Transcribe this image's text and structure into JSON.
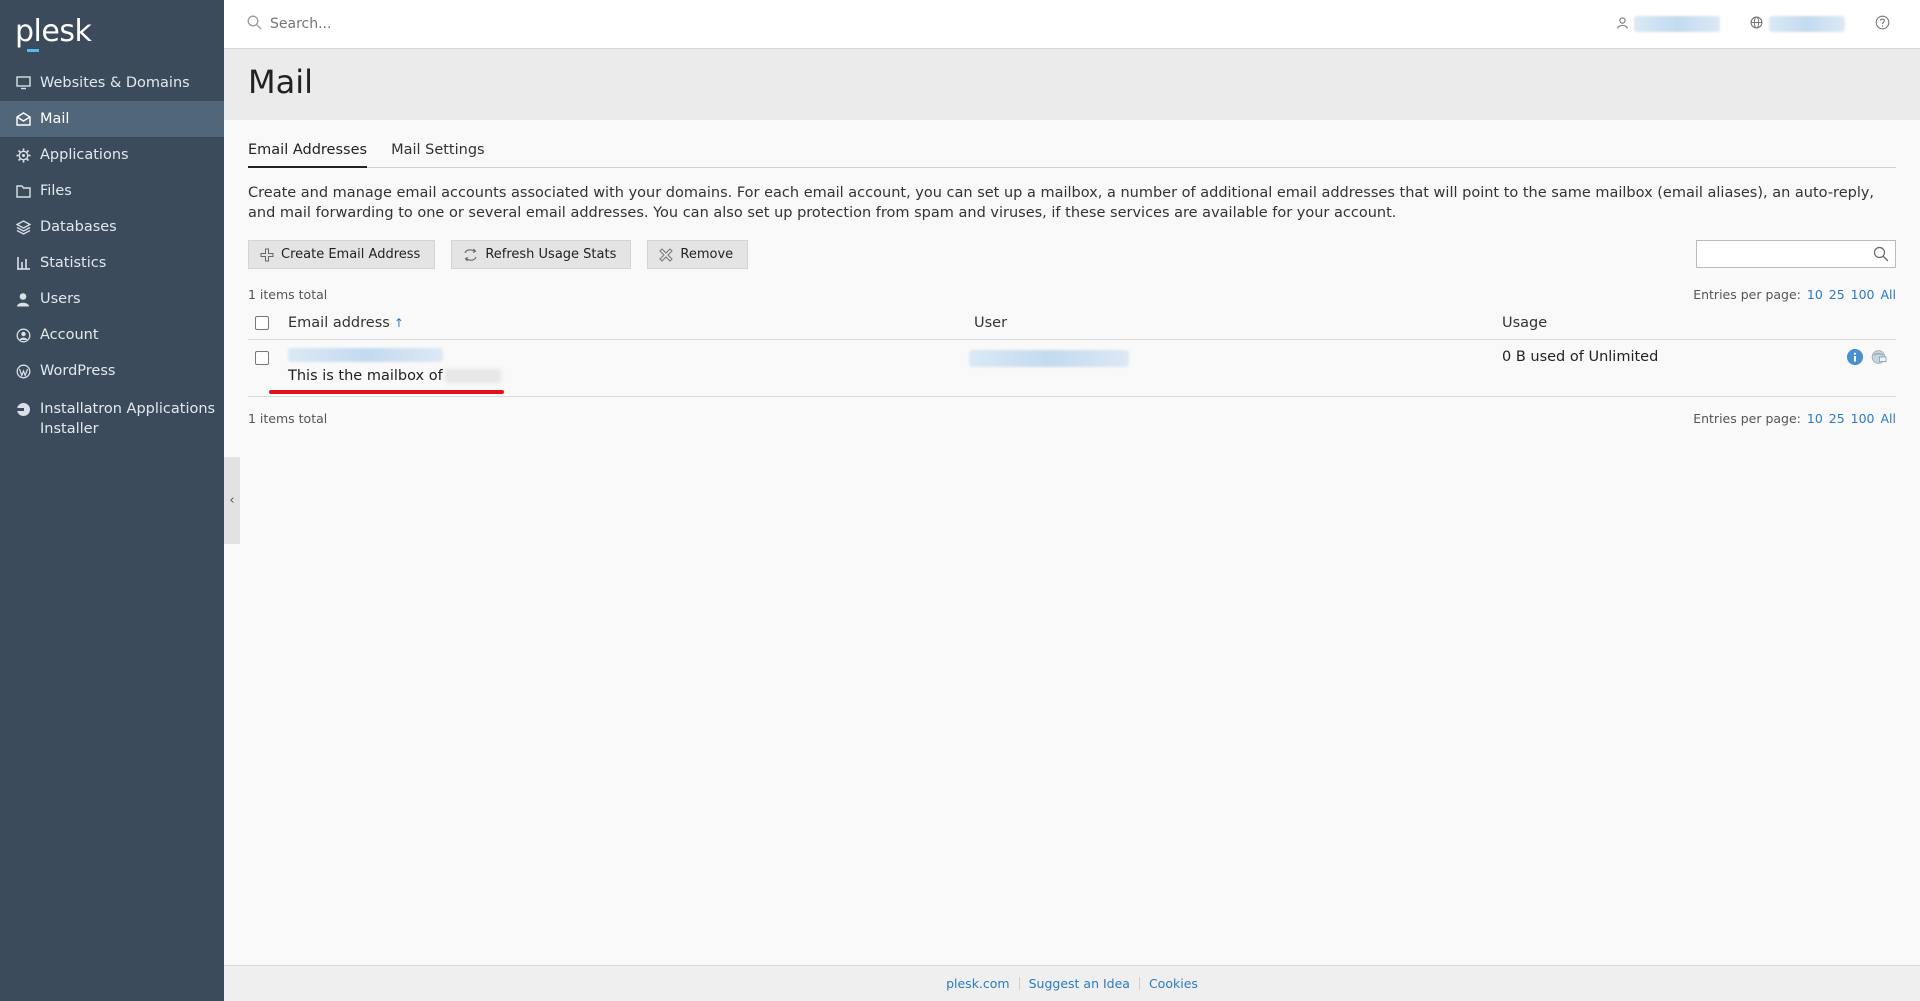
{
  "app": {
    "logo_text": "plesk"
  },
  "sidebar": {
    "items": [
      {
        "label": "Websites & Domains",
        "icon": "monitor-icon"
      },
      {
        "label": "Mail",
        "icon": "mail-icon",
        "active": true
      },
      {
        "label": "Applications",
        "icon": "gear-icon"
      },
      {
        "label": "Files",
        "icon": "folder-icon"
      },
      {
        "label": "Databases",
        "icon": "layers-icon"
      },
      {
        "label": "Statistics",
        "icon": "bar-chart-icon"
      },
      {
        "label": "Users",
        "icon": "user-icon"
      },
      {
        "label": "Account",
        "icon": "account-icon"
      },
      {
        "label": "WordPress",
        "icon": "wordpress-icon"
      },
      {
        "label": "Installatron Applications Installer",
        "icon": "installatron-icon"
      }
    ]
  },
  "topbar": {
    "search_placeholder": "Search..."
  },
  "page": {
    "title": "Mail"
  },
  "tabs": [
    {
      "label": "Email Addresses",
      "active": true
    },
    {
      "label": "Mail Settings",
      "active": false
    }
  ],
  "description": "Create and manage email accounts associated with your domains. For each email account, you can set up a mailbox, a number of additional email addresses that will point to the same mailbox (email aliases), an auto-reply, and mail forwarding to one or several email addresses. You can also set up protection from spam and viruses, if these services are available for your account.",
  "toolbar": {
    "create_label": "Create Email Address",
    "refresh_label": "Refresh Usage Stats",
    "remove_label": "Remove"
  },
  "list": {
    "total_text": "1 items total",
    "entries_label": "Entries per page:",
    "entries_options": [
      "10",
      "25",
      "100",
      "All"
    ],
    "columns": {
      "email": "Email address",
      "sort_arrow": "↑",
      "user": "User",
      "usage": "Usage"
    },
    "rows": [
      {
        "description": "This is the mailbox of",
        "usage": "0 B used of Unlimited"
      }
    ]
  },
  "footer": {
    "links": [
      "plesk.com",
      "Suggest an Idea",
      "Cookies"
    ]
  },
  "colors": {
    "sidebar": "#3c4b5b",
    "active_item": "#52667a",
    "link": "#2b7bc4",
    "highlight": "#e0121b"
  }
}
